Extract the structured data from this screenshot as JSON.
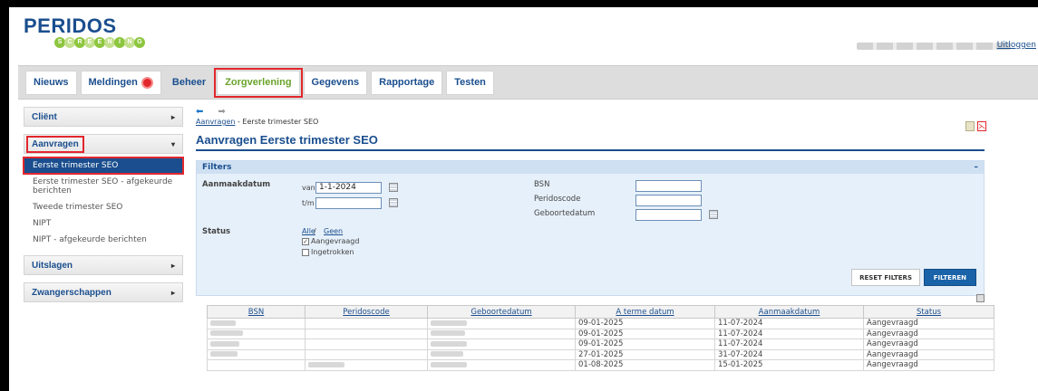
{
  "logo": {
    "name": "PERIDOS",
    "sub_letters": [
      "S",
      "C",
      "R",
      "E",
      "E",
      "N",
      "I",
      "N",
      "G"
    ]
  },
  "header": {
    "logout": "Uitloggen"
  },
  "topnav": {
    "tabs": [
      {
        "label": "Nieuws"
      },
      {
        "label": "Meldingen"
      },
      {
        "label": "Beheer"
      },
      {
        "label": "Zorgverlening"
      },
      {
        "label": "Gegevens"
      },
      {
        "label": "Rapportage"
      },
      {
        "label": "Testen"
      }
    ],
    "active": "Zorgverlening"
  },
  "sidebar": {
    "client": "Cliënt",
    "aanvragen": "Aanvragen",
    "aanvragen_items": [
      "Eerste trimester SEO",
      "Eerste trimester SEO - afgekeurde berichten",
      "Tweede trimester SEO",
      "NIPT",
      "NIPT - afgekeurde berichten"
    ],
    "uitslagen": "Uitslagen",
    "zwangerschappen": "Zwangerschappen"
  },
  "breadcrumb": {
    "link": "Aanvragen",
    "rest": " - Eerste trimester SEO"
  },
  "page_title": "Aanvragen Eerste trimester SEO",
  "filters": {
    "title": "Filters",
    "collapse": "–",
    "aanmaakdatum_label": "Aanmaakdatum",
    "van": "van",
    "van_value": "1-1-2024",
    "tm": "t/m",
    "tm_value": "",
    "bsn_label": "BSN",
    "peridoscode_label": "Peridoscode",
    "geboortedatum_label": "Geboortedatum",
    "status_label": "Status",
    "alle": "Alle",
    "slash": " / ",
    "geen": "Geen",
    "check_aangevraagd": "Aangevraagd",
    "check_ingetrokken": "Ingetrokken",
    "reset_button": "RESET FILTERS",
    "filter_button": "FILTEREN"
  },
  "table": {
    "headers": [
      "BSN",
      "Peridoscode",
      "Geboortedatum",
      "A terme datum",
      "Aanmaakdatum",
      "Status"
    ],
    "rows": [
      {
        "a_terme": "09-01-2025",
        "aanmaak": "11-07-2024",
        "status": "Aangevraagd"
      },
      {
        "a_terme": "09-01-2025",
        "aanmaak": "11-07-2024",
        "status": "Aangevraagd"
      },
      {
        "a_terme": "09-01-2025",
        "aanmaak": "11-07-2024",
        "status": "Aangevraagd"
      },
      {
        "a_terme": "27-01-2025",
        "aanmaak": "31-07-2024",
        "status": "Aangevraagd"
      },
      {
        "a_terme": "01-08-2025",
        "aanmaak": "15-01-2025",
        "status": "Aangevraagd"
      }
    ]
  }
}
